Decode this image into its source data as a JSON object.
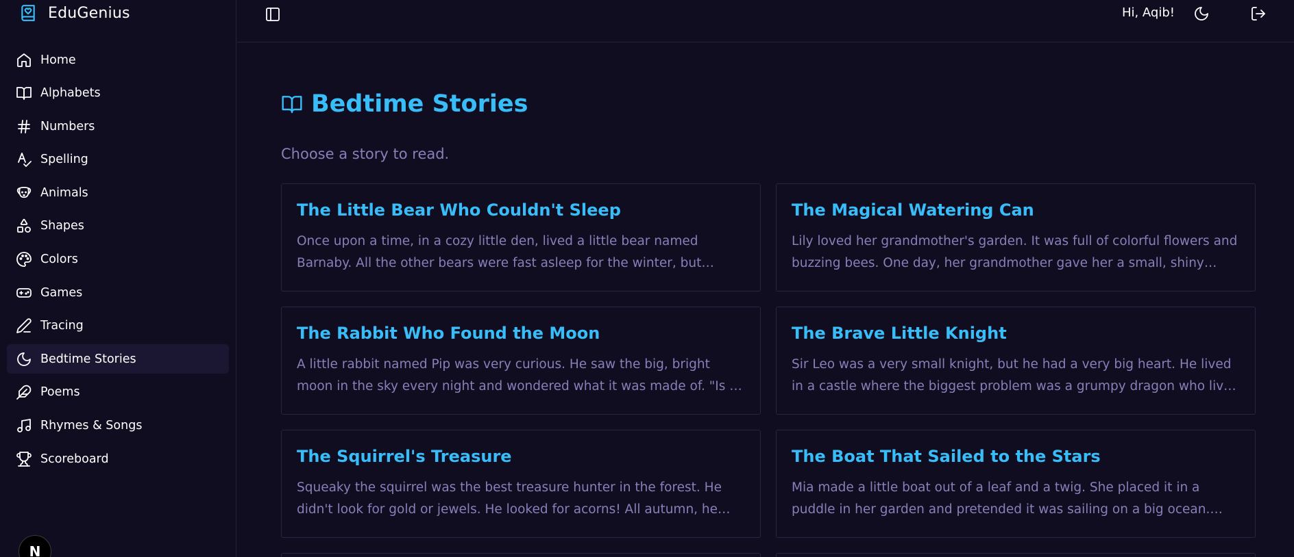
{
  "brand": {
    "name": "EduGenius"
  },
  "sidebar": {
    "items": [
      {
        "label": "Home",
        "icon": "home-icon"
      },
      {
        "label": "Alphabets",
        "icon": "book-open-icon"
      },
      {
        "label": "Numbers",
        "icon": "hash-icon"
      },
      {
        "label": "Spelling",
        "icon": "spell-check-icon"
      },
      {
        "label": "Animals",
        "icon": "dog-icon"
      },
      {
        "label": "Shapes",
        "icon": "shapes-icon"
      },
      {
        "label": "Colors",
        "icon": "palette-icon"
      },
      {
        "label": "Games",
        "icon": "gamepad-icon"
      },
      {
        "label": "Tracing",
        "icon": "pencil-icon"
      },
      {
        "label": "Bedtime Stories",
        "icon": "moon-icon",
        "active": true
      },
      {
        "label": "Poems",
        "icon": "feather-icon"
      },
      {
        "label": "Rhymes & Songs",
        "icon": "music-icon"
      },
      {
        "label": "Scoreboard",
        "icon": "trophy-icon"
      }
    ],
    "footer_badge": "N"
  },
  "header": {
    "greeting": "Hi, Aqib!"
  },
  "main": {
    "title": "Bedtime Stories",
    "subtitle": "Choose a story to read.",
    "stories": [
      {
        "title": "The Little Bear Who Couldn't Sleep",
        "excerpt": "Once upon a time, in a cozy little den, lived a little bear named Barnaby. All the other bears were fast asleep for the winter, but…"
      },
      {
        "title": "The Magical Watering Can",
        "excerpt": "Lily loved her grandmother's garden. It was full of colorful flowers and buzzing bees. One day, her grandmother gave her a small, shiny…"
      },
      {
        "title": "The Rabbit Who Found the Moon",
        "excerpt": "A little rabbit named Pip was very curious. He saw the big, bright moon in the sky every night and wondered what it was made of. \"Is it a big…"
      },
      {
        "title": "The Brave Little Knight",
        "excerpt": "Sir Leo was a very small knight, but he had a very big heart. He lived in a castle where the biggest problem was a grumpy dragon who lived i…"
      },
      {
        "title": "The Squirrel's Treasure",
        "excerpt": "Squeaky the squirrel was the best treasure hunter in the forest. He didn't look for gold or jewels. He looked for acorns! All autumn, he…"
      },
      {
        "title": "The Boat That Sailed to the Stars",
        "excerpt": "Mia made a little boat out of a leaf and a twig. She placed it in a puddle in her garden and pretended it was sailing on a big ocean. As…"
      }
    ]
  },
  "colors": {
    "accent": "#38bdf8",
    "background": "#100d20",
    "muted_text": "#8a7fb8",
    "border": "#2a2545"
  }
}
